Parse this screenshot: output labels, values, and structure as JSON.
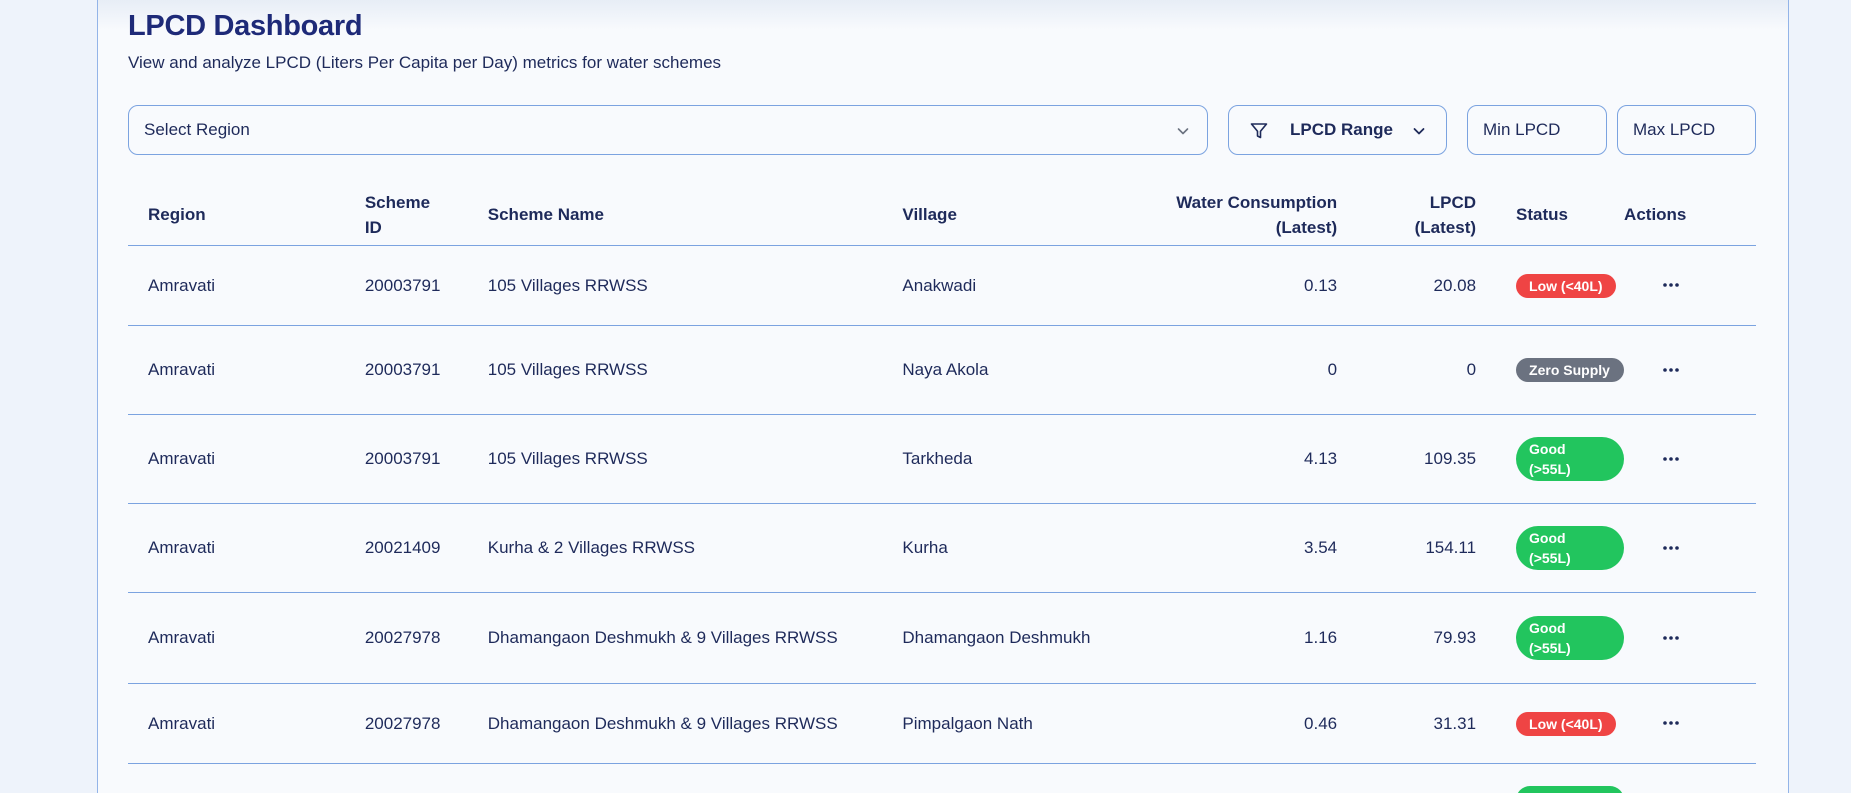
{
  "header": {
    "title": "LPCD Dashboard",
    "subtitle": "View and analyze LPCD (Liters Per Capita per Day) metrics for water schemes"
  },
  "filters": {
    "region_placeholder": "Select Region",
    "range_label": "LPCD Range",
    "min_placeholder": "Min LPCD",
    "max_placeholder": "Max LPCD"
  },
  "table": {
    "headers": {
      "region": "Region",
      "scheme_id_1": "Scheme",
      "scheme_id_2": "ID",
      "scheme_name": "Scheme Name",
      "village": "Village",
      "water_1": "Water Consumption",
      "water_2": "(Latest)",
      "lpcd_1": "LPCD",
      "lpcd_2": "(Latest)",
      "status": "Status",
      "actions": "Actions"
    },
    "rows": [
      {
        "region": "Amravati",
        "scheme_id": "20003791",
        "scheme_name": "105 Villages RRWSS",
        "village": "Anakwadi",
        "water": "0.13",
        "lpcd": "20.08",
        "status": "Low (<40L)",
        "status_type": "low"
      },
      {
        "region": "Amravati",
        "scheme_id": "20003791",
        "scheme_name": "105 Villages RRWSS",
        "village": "Naya Akola",
        "water": "0",
        "lpcd": "0",
        "status": "Zero Supply",
        "status_type": "zero"
      },
      {
        "region": "Amravati",
        "scheme_id": "20003791",
        "scheme_name": "105 Villages RRWSS",
        "village": "Tarkheda",
        "water": "4.13",
        "lpcd": "109.35",
        "status": "Good (>55L)",
        "status_type": "good"
      },
      {
        "region": "Amravati",
        "scheme_id": "20021409",
        "scheme_name": "Kurha & 2 Villages RRWSS",
        "village": "Kurha",
        "water": "3.54",
        "lpcd": "154.11",
        "status": "Good (>55L)",
        "status_type": "good"
      },
      {
        "region": "Amravati",
        "scheme_id": "20027978",
        "scheme_name": "Dhamangaon Deshmukh & 9 Villages RRWSS",
        "village": "Dhamangaon Deshmukh",
        "water": "1.16",
        "lpcd": "79.93",
        "status": "Good (>55L)",
        "status_type": "good"
      },
      {
        "region": "Amravati",
        "scheme_id": "20027978",
        "scheme_name": "Dhamangaon Deshmukh & 9 Villages RRWSS",
        "village": "Pimpalgaon Nath",
        "water": "0.46",
        "lpcd": "31.31",
        "status": "Low (<40L)",
        "status_type": "low"
      }
    ]
  },
  "colors": {
    "low": "#ef4444",
    "zero": "#6b7280",
    "good": "#22c55e",
    "border": "#7ba3e0",
    "text": "#1e2a5a"
  },
  "icons": {
    "region_select": "chevron-down-icon",
    "range": "filter-icon",
    "range_dropdown": "chevron-down-icon",
    "row_action": "more-horizontal-icon"
  }
}
